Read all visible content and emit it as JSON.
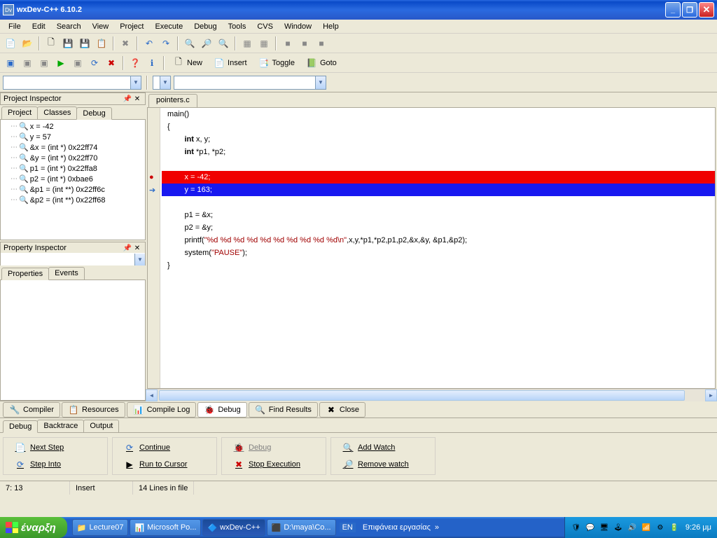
{
  "window": {
    "title": "wxDev-C++  6.10.2"
  },
  "menus": [
    "File",
    "Edit",
    "Search",
    "View",
    "Project",
    "Execute",
    "Debug",
    "Tools",
    "CVS",
    "Window",
    "Help"
  ],
  "toolbar_text_buttons": {
    "new": "New",
    "insert": "Insert",
    "toggle": "Toggle",
    "goto": "Goto"
  },
  "panels": {
    "project_inspector": {
      "title": "Project Inspector",
      "tabs": [
        "Project",
        "Classes",
        "Debug"
      ],
      "active": 2
    },
    "property_inspector": {
      "title": "Property Inspector",
      "tabs": [
        "Properties",
        "Events"
      ],
      "active": 0
    }
  },
  "debug_watch": [
    "x = -42",
    "y = 57",
    "&x = (int *) 0x22ff74",
    "&y = (int *) 0x22ff70",
    "p1 = (int *) 0x22ffa8",
    "p2 = (int *) 0xbae6",
    "&p1 = (int **) 0x22ff6c",
    "&p2 = (int **) 0x22ff68"
  ],
  "editor": {
    "tab": "pointers.c",
    "lines": [
      {
        "t": "main()",
        "indent": 0
      },
      {
        "t": "{",
        "indent": 0
      },
      {
        "kw": "int",
        "rest": " x, y;",
        "indent": 2
      },
      {
        "kw": "int",
        "rest": " *p1, *p2;",
        "indent": 2
      },
      {
        "blank": true
      },
      {
        "t": "x = -42;",
        "indent": 2,
        "hl": "red",
        "bp": true
      },
      {
        "t": "y = 163;",
        "indent": 2,
        "hl": "blue",
        "cur": true
      },
      {
        "blank": true
      },
      {
        "t": "p1 = &x;",
        "indent": 2
      },
      {
        "t": "p2 = &y;",
        "indent": 2
      },
      {
        "printf": true,
        "indent": 2
      },
      {
        "system": true,
        "indent": 2
      },
      {
        "t": "}",
        "indent": 0
      }
    ],
    "printf_str": "\"%d %d %d %d %d %d %d %d %d %d\\n\"",
    "printf_args": ",x,y,*p1,*p2,p1,p2,&x,&y, &p1,&p2",
    "system_str": "\"PAUSE\""
  },
  "bottom_tabs": [
    {
      "icon": "🔧",
      "label": "Compiler"
    },
    {
      "icon": "📋",
      "label": "Resources"
    },
    {
      "icon": "📊",
      "label": "Compile Log"
    },
    {
      "icon": "🐞",
      "label": "Debug",
      "active": true
    },
    {
      "icon": "🔍",
      "label": "Find Results"
    },
    {
      "icon": "✖",
      "label": "Close"
    }
  ],
  "debug_panel": {
    "tabs": [
      "Debug",
      "Backtrace",
      "Output"
    ],
    "active": 0,
    "buttons": {
      "next_step": "Next Step",
      "step_into": "Step Into",
      "continue": "Continue",
      "run_to_cursor": "Run to Cursor",
      "debug": "Debug",
      "stop_execution": "Stop Execution",
      "add_watch": "Add Watch",
      "remove_watch": "Remove watch"
    }
  },
  "statusbar": {
    "pos": "7: 13",
    "mode": "Insert",
    "lines": "14 Lines in file"
  },
  "taskbar": {
    "start": "έναρξη",
    "tasks": [
      {
        "icon": "📁",
        "label": "Lecture07"
      },
      {
        "icon": "📊",
        "label": "Microsoft Po..."
      },
      {
        "icon": "🔷",
        "label": "wxDev-C++",
        "active": true
      },
      {
        "icon": "⬛",
        "label": "D:\\maya\\Co..."
      }
    ],
    "lang": "EN",
    "desk_text": "Επιφάνεια εργασίας",
    "clock": "9:26 μμ"
  }
}
